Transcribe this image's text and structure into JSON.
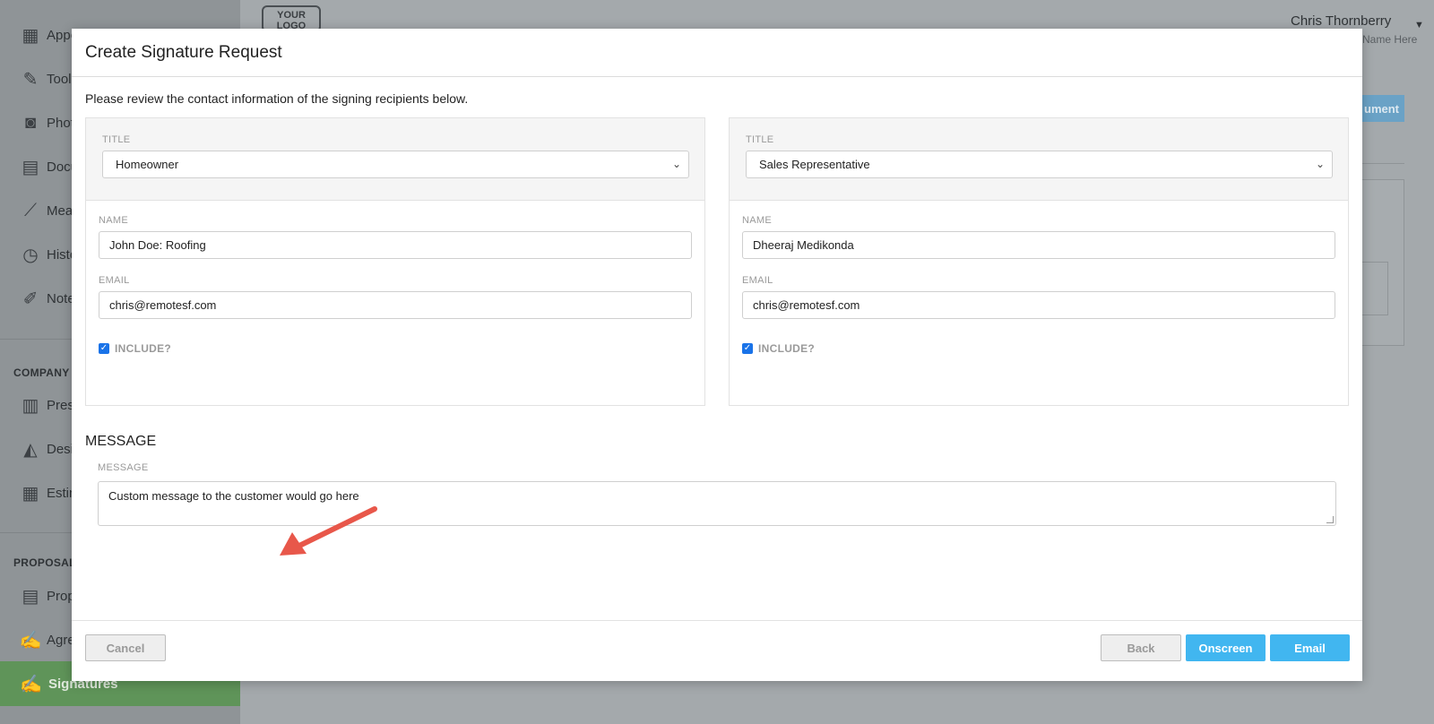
{
  "background": {
    "sidebar_items": [
      {
        "icon": "calendar-icon",
        "glyph": "▦",
        "label": "Appo"
      },
      {
        "icon": "tools-icon",
        "glyph": "✎",
        "label": "Tool"
      },
      {
        "icon": "camera-icon",
        "glyph": "◙",
        "label": "Phot"
      },
      {
        "icon": "folder-icon",
        "glyph": "▤",
        "label": "Docu"
      },
      {
        "icon": "ruler-icon",
        "glyph": "⟋",
        "label": "Mea"
      },
      {
        "icon": "clock-icon",
        "glyph": "◷",
        "label": "Histo"
      },
      {
        "icon": "notes-icon",
        "glyph": "✐",
        "label": "Note"
      }
    ],
    "section_company": "COMPANY R",
    "company_items": [
      {
        "icon": "presentation-icon",
        "glyph": "▥",
        "label": "Pres"
      },
      {
        "icon": "design-icon",
        "glyph": "◭",
        "label": "Desi"
      },
      {
        "icon": "calculator-icon",
        "glyph": "▦",
        "label": "Estim"
      }
    ],
    "section_proposal": "PROPOSAL",
    "proposal_items": [
      {
        "icon": "proposal-icon",
        "glyph": "▤",
        "label": "Prop"
      },
      {
        "icon": "agreement-icon",
        "glyph": "✍",
        "label": "Agre"
      }
    ],
    "active_item": {
      "icon": "signature-icon",
      "glyph": "✍",
      "label": "Signatures"
    },
    "logo_text": "YOUR LOGO",
    "user_name": "Chris Thornberry",
    "company_name": "Name Here",
    "bg_button": "ument"
  },
  "modal": {
    "title": "Create Signature Request",
    "intro": "Please review the contact information of the signing recipients below.",
    "title_label": "TITLE",
    "name_label": "NAME",
    "email_label": "EMAIL",
    "include_label": "INCLUDE?",
    "recipients": [
      {
        "title": "Homeowner",
        "name": "John Doe: Roofing",
        "email": "chris@remotesf.com",
        "include": true
      },
      {
        "title": "Sales Representative",
        "name": "Dheeraj Medikonda",
        "email": "chris@remotesf.com",
        "include": true
      }
    ],
    "message_heading": "MESSAGE",
    "message_label": "MESSAGE",
    "message_value": "Custom message to the customer would go here",
    "buttons": {
      "cancel": "Cancel",
      "back": "Back",
      "onscreen": "Onscreen",
      "email": "Email"
    },
    "colors": {
      "primary": "#41b6f0",
      "arrow": "#e8574a",
      "checkbox": "#1a73e8"
    }
  }
}
